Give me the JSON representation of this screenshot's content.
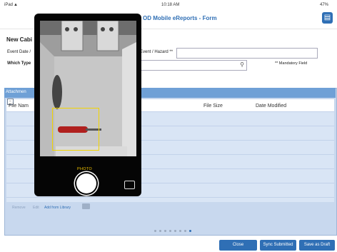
{
  "status_bar": {
    "carrier": "iPad",
    "wifi": "▲",
    "time": "10:18 AM",
    "battery": "47%"
  },
  "header": {
    "title": "OD Mobile eReports - Form",
    "forms_icon": "document-icon"
  },
  "form": {
    "title": "New Cabi",
    "event_date_label": "Event Date /",
    "event_hazard_label": "Event / Hazard **",
    "event_hazard_value": "",
    "which_type_label": "Which Type",
    "which_type_value": "",
    "mandatory_note": "** Mandatory Field"
  },
  "attachments": {
    "title": "Attachmen",
    "columns": [
      "File Nam",
      "File Size",
      "Date Modified"
    ],
    "toolbar": {
      "remove": "Remove",
      "edit": "Edit",
      "add": "Add from Library"
    }
  },
  "pagination": {
    "pages": 8,
    "current": 8
  },
  "buttons": {
    "close": "Close",
    "sync": "Sync Submitted",
    "draft": "Save as Draft"
  },
  "camera": {
    "mode_label": "PHOTO"
  },
  "colors": {
    "accent": "#2f6fb5",
    "panel": "#c8d8ee",
    "focus": "#f2d400"
  }
}
